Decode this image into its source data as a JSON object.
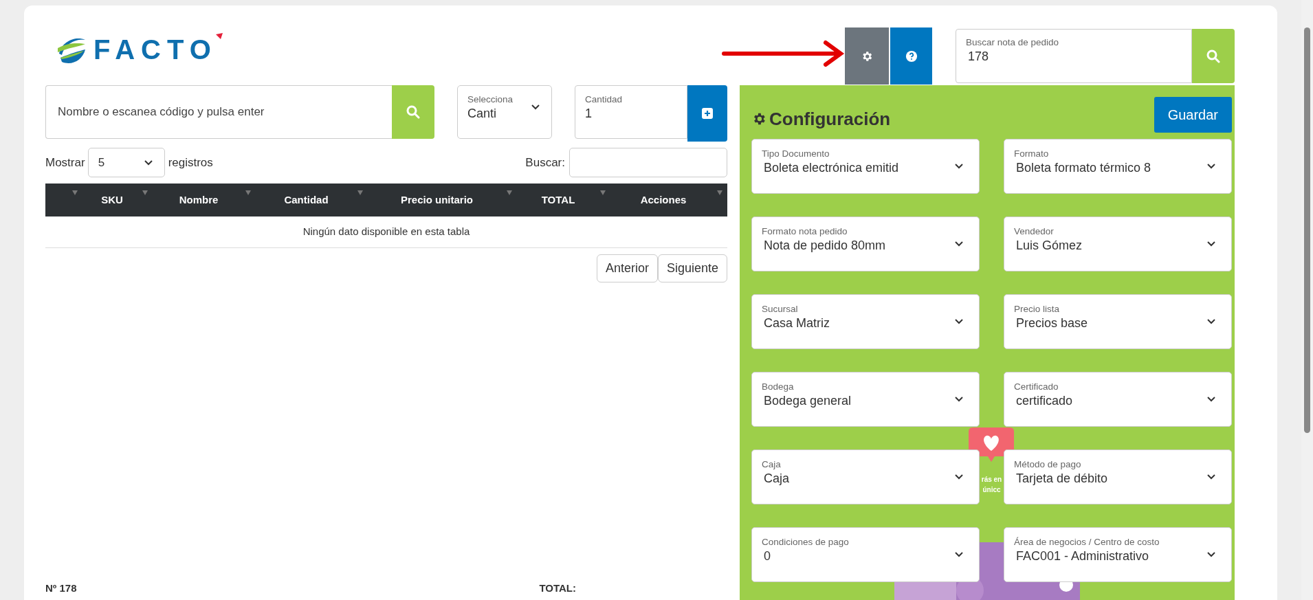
{
  "logo": {
    "text": "FACTO"
  },
  "order_search": {
    "label": "Buscar nota de pedido",
    "value": "178"
  },
  "product_search": {
    "placeholder": "Nombre o escanea código y pulsa enter"
  },
  "mode_select": {
    "label": "Selecciona",
    "value": "Canti"
  },
  "quantity": {
    "label": "Cantidad",
    "value": "1"
  },
  "table_controls": {
    "show_label": "Mostrar",
    "page_size": "5",
    "records_label": "registros",
    "search_label": "Buscar:"
  },
  "table": {
    "columns": [
      "SKU",
      "Nombre",
      "Cantidad",
      "Precio unitario",
      "TOTAL",
      "Acciones"
    ],
    "empty_message": "Ningún dato disponible en esta tabla"
  },
  "pagination": [
    "Anterior",
    "Siguiente"
  ],
  "config": {
    "title": "Configuración",
    "save": "Guardar",
    "fields": [
      {
        "label": "Tipo Documento",
        "value": "Boleta electrónica emitid"
      },
      {
        "label": "Formato",
        "value": "Boleta formato térmico 8"
      },
      {
        "label": "Formato nota pedido",
        "value": "Nota de pedido 80mm"
      },
      {
        "label": "Vendedor",
        "value": "Luis Gómez"
      },
      {
        "label": "Sucursal",
        "value": "Casa Matriz"
      },
      {
        "label": "Precio lista",
        "value": "Precios base"
      },
      {
        "label": "Bodega",
        "value": "Bodega general"
      },
      {
        "label": "Certificado",
        "value": "certificado"
      },
      {
        "label": "Caja",
        "value": "Caja"
      },
      {
        "label": "Método de pago",
        "value": "Tarjeta de débito"
      },
      {
        "label": "Condiciones de pago",
        "value": "0"
      },
      {
        "label": "Área de negocios / Centro de costo",
        "value": "FAC001 - Administrativo"
      }
    ]
  },
  "illustration": {
    "texts": [
      "rás en",
      "únicc"
    ]
  },
  "footer": {
    "order_number": "Nº 178",
    "total_label": "TOTAL:"
  }
}
